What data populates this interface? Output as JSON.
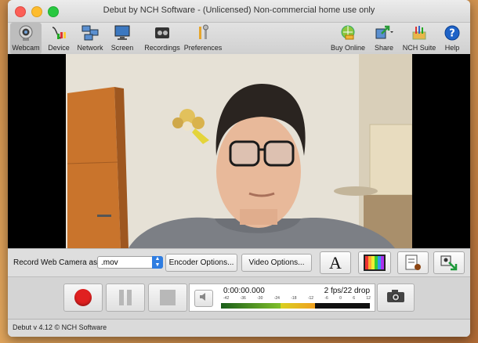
{
  "window": {
    "title": "Debut by NCH Software - (Unlicensed) Non-commercial home use only"
  },
  "toolbar": {
    "items": [
      {
        "label": "Webcam",
        "icon": "webcam-icon"
      },
      {
        "label": "Device",
        "icon": "device-cable-icon"
      },
      {
        "label": "Network",
        "icon": "network-icon"
      },
      {
        "label": "Screen",
        "icon": "monitor-icon"
      },
      {
        "label": "Recordings",
        "icon": "film-reel-icon"
      },
      {
        "label": "Preferences",
        "icon": "tools-icon"
      },
      {
        "label": "Buy Online",
        "icon": "cart-globe-icon"
      },
      {
        "label": "Share",
        "icon": "share-icon"
      },
      {
        "label": "NCH Suite",
        "icon": "toolbox-icon"
      },
      {
        "label": "Help",
        "icon": "question-icon"
      }
    ]
  },
  "record": {
    "label": "Record Web Camera as:",
    "format": ".mov",
    "encoder_options": "Encoder Options...",
    "video_options": "Video Options..."
  },
  "effects": {
    "text_button": "A",
    "color_icon": "color-bars-icon",
    "caption_icon": "document-stamp-icon",
    "overlay_icon": "overlay-arrow-icon"
  },
  "transport": {
    "time": "0:00:00.000",
    "fps": "2 fps/22 drop",
    "meter_ticks": [
      "-42",
      "-36",
      "-30",
      "-24",
      "-18",
      "-12",
      "-6",
      "0",
      "6",
      "12"
    ],
    "volume_icon": "speaker-icon",
    "snapshot_icon": "camera-icon"
  },
  "status": {
    "version": "Debut v 4.12 © NCH Software"
  },
  "colors": {
    "record": "#e02020",
    "accent": "#2f7de1"
  }
}
